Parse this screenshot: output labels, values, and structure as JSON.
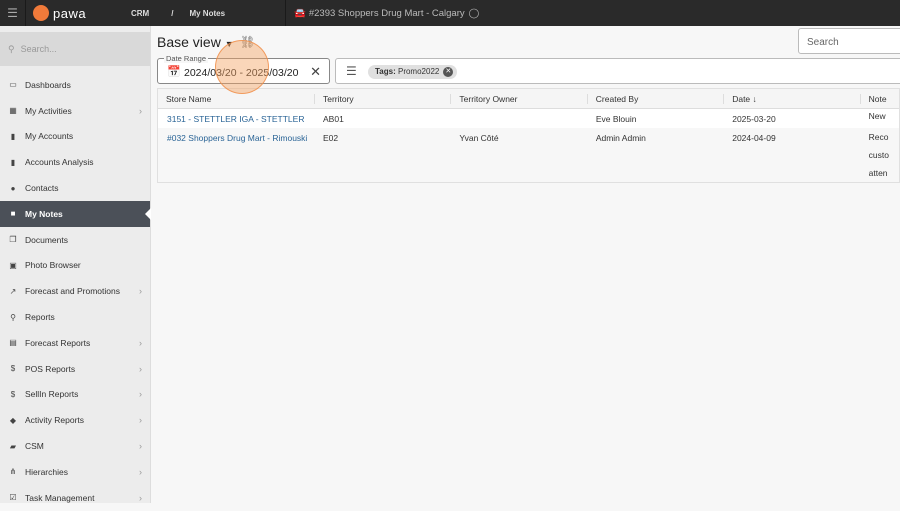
{
  "topbar": {
    "logo": "pawa",
    "crumbs": [
      "CRM",
      "My Notes"
    ],
    "separator": "/",
    "store": "#2393 Shoppers Drug Mart - Calgary"
  },
  "sidebar": {
    "search_placeholder": "Search...",
    "items": [
      {
        "label": "Dashboards",
        "icon": "dashboard-icon",
        "chevron": false
      },
      {
        "label": "My Activities",
        "icon": "calendar-icon",
        "chevron": true
      },
      {
        "label": "My Accounts",
        "icon": "building-icon",
        "chevron": false
      },
      {
        "label": "Accounts Analysis",
        "icon": "building-icon",
        "chevron": false
      },
      {
        "label": "Contacts",
        "icon": "person-icon",
        "chevron": false
      },
      {
        "label": "My Notes",
        "icon": "note-icon",
        "chevron": false,
        "active": true
      },
      {
        "label": "Documents",
        "icon": "documents-icon",
        "chevron": false
      },
      {
        "label": "Photo Browser",
        "icon": "photo-icon",
        "chevron": false
      },
      {
        "label": "Forecast and Promotions",
        "icon": "chart-icon",
        "chevron": true
      },
      {
        "label": "Reports",
        "icon": "search-icon",
        "chevron": false
      },
      {
        "label": "Forecast Reports",
        "icon": "doc-icon",
        "chevron": true
      },
      {
        "label": "POS Reports",
        "icon": "dollar-icon",
        "chevron": true
      },
      {
        "label": "SellIn Reports",
        "icon": "dollar-icon",
        "chevron": true
      },
      {
        "label": "Activity Reports",
        "icon": "cube-icon",
        "chevron": true
      },
      {
        "label": "CSM",
        "icon": "book-icon",
        "chevron": true
      },
      {
        "label": "Hierarchies",
        "icon": "hierarchy-icon",
        "chevron": true
      },
      {
        "label": "Task Management",
        "icon": "task-icon",
        "chevron": true
      }
    ]
  },
  "main": {
    "view": "Base view",
    "search_placeholder": "Search",
    "date_label": "Date Range",
    "date_value": "2024/03/20 - 2025/03/20",
    "chip_key": "Tags:",
    "chip_value": "Promo2022",
    "columns": [
      "Store Name",
      "Territory",
      "Territory Owner",
      "Created By",
      "Date ↓",
      "Note"
    ],
    "rows": [
      {
        "store": "3151 - STETTLER IGA - STETTLER",
        "territory": "AB01",
        "owner": "",
        "created_by": "Eve Blouin",
        "date": "2025-03-20",
        "note": [
          "New"
        ]
      },
      {
        "store": "#032 Shoppers Drug Mart - Rimouski",
        "territory": "E02",
        "owner": "Yvan Côté",
        "created_by": "Admin Admin",
        "date": "2024-04-09",
        "note": [
          "Reco",
          "custo",
          "atten"
        ]
      }
    ]
  }
}
